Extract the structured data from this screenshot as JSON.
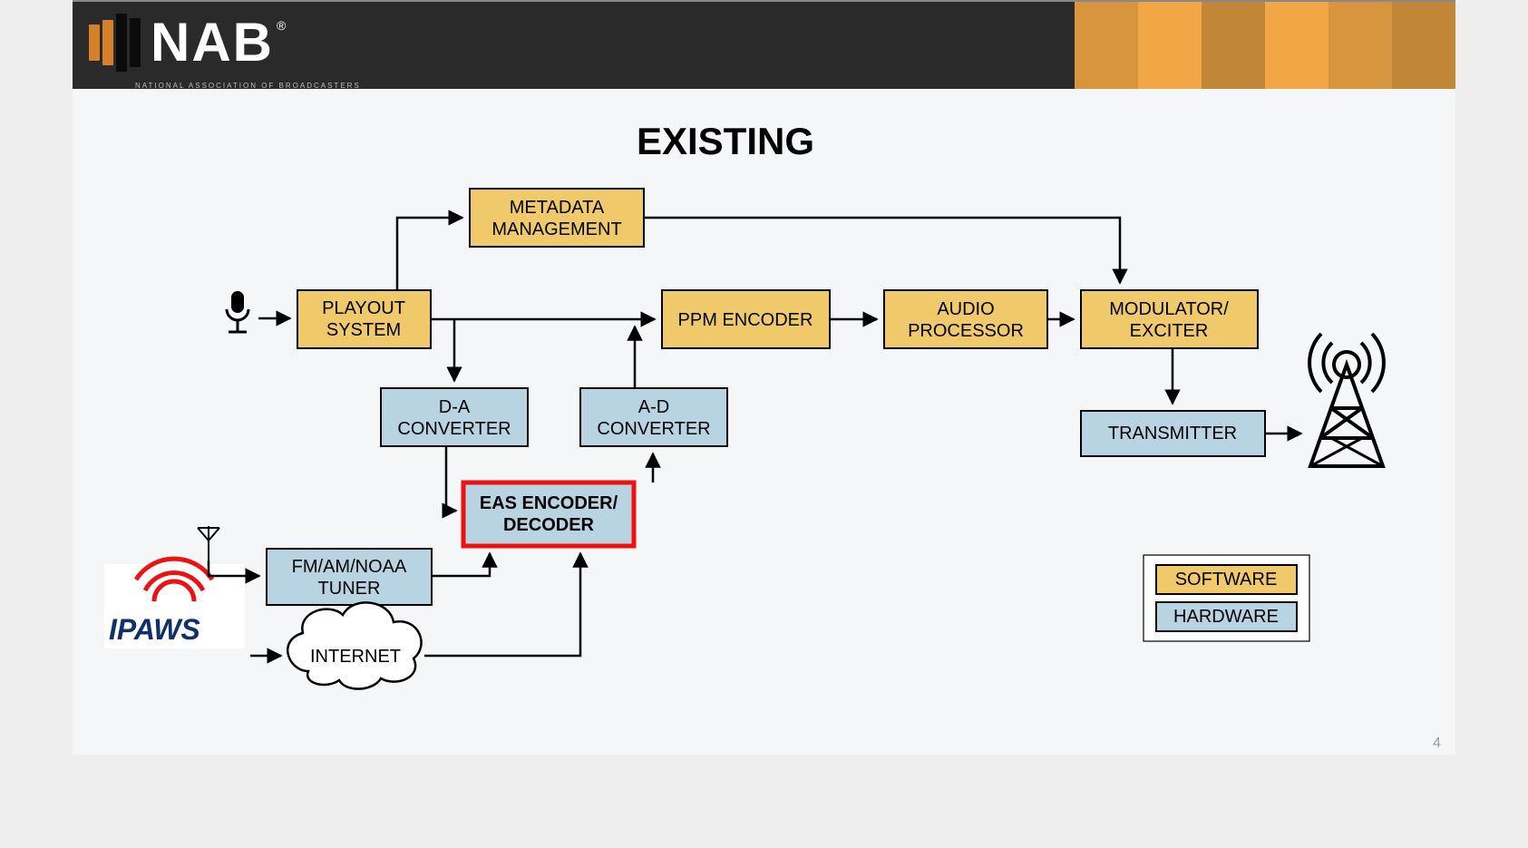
{
  "logo": {
    "text": "NAB",
    "subtitle": "NATIONAL ASSOCIATION OF BROADCASTERS"
  },
  "title": "EXISTING",
  "page_number": "4",
  "legend": {
    "software": "SOFTWARE",
    "hardware": "HARDWARE"
  },
  "blocks": {
    "playout": "PLAYOUT SYSTEM",
    "metadata1": "METADATA",
    "metadata2": "MANAGEMENT",
    "da1": "D-A",
    "da2": "CONVERTER",
    "ad1": "A-D",
    "ad2": "CONVERTER",
    "eas1": "EAS ENCODER/",
    "eas2": "DECODER",
    "tuner1": "FM/AM/NOAA",
    "tuner2": "TUNER",
    "internet": "INTERNET",
    "ppm": "PPM ENCODER",
    "audio1": "AUDIO",
    "audio2": "PROCESSOR",
    "mod1": "MODULATOR/",
    "mod2": "EXCITER",
    "tx": "TRANSMITTER",
    "ipaws": "IPAWS"
  }
}
